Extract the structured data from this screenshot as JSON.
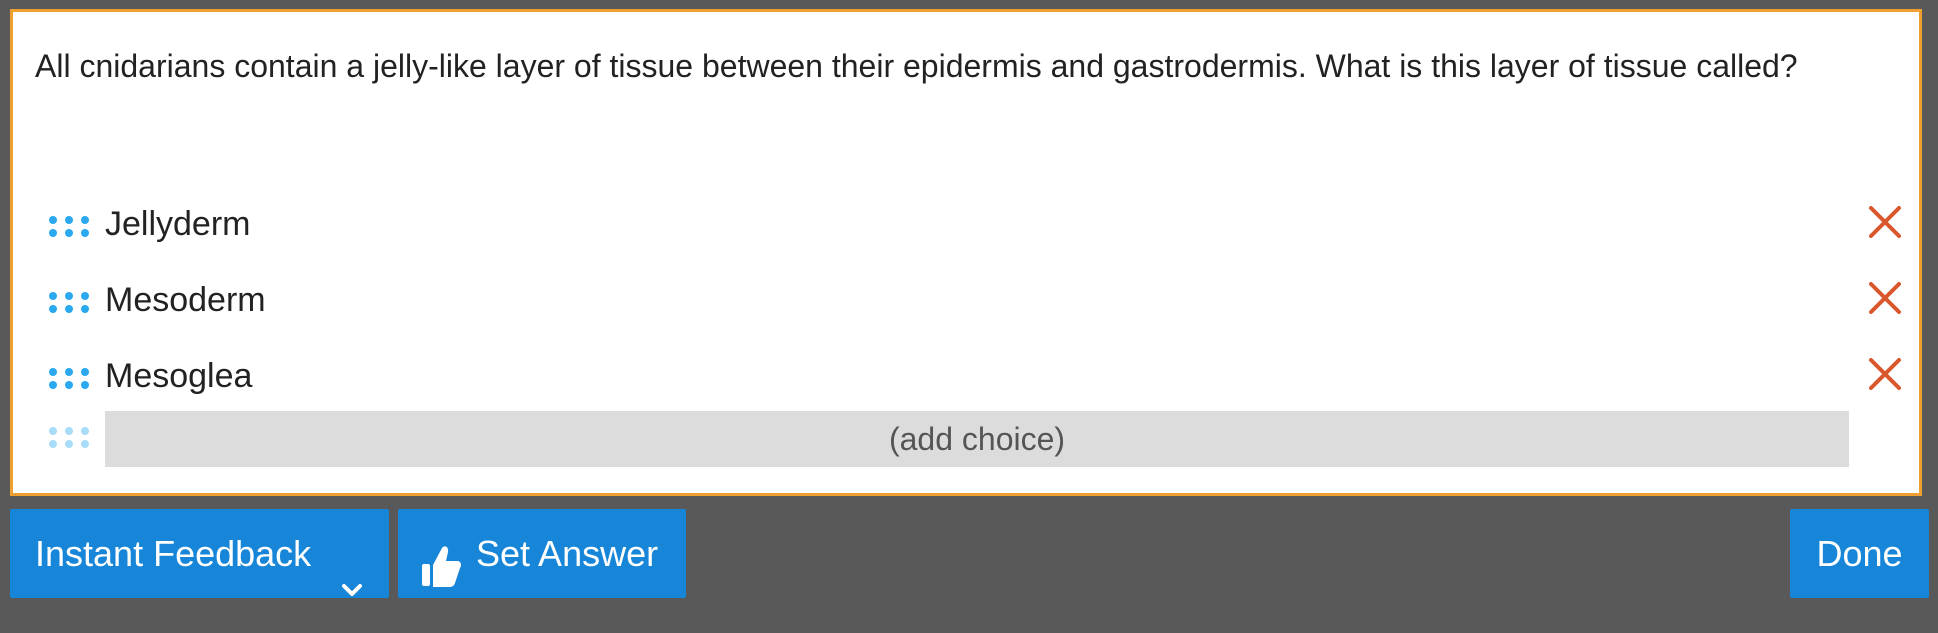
{
  "question": {
    "text": "All cnidarians contain a jelly-like layer of tissue between their epidermis and gastrodermis. What is this layer of tissue called?"
  },
  "choices": [
    {
      "label": "Jellyderm"
    },
    {
      "label": "Mesoderm"
    },
    {
      "label": "Mesoglea"
    }
  ],
  "add_choice": {
    "label": "(add choice)"
  },
  "toolbar": {
    "instant_feedback_label": "Instant Feedback",
    "set_answer_label": "Set Answer",
    "done_label": "Done"
  },
  "colors": {
    "accent": "#1786d9",
    "card_border": "#f0a030",
    "grip": "#2aa8f0",
    "remove": "#d9572b",
    "background": "#595959"
  },
  "icons": {
    "grip": "drag-handle-icon",
    "remove": "close-icon",
    "dropdown": "chevron-down-icon",
    "set_answer": "thumbs-up-icon"
  }
}
